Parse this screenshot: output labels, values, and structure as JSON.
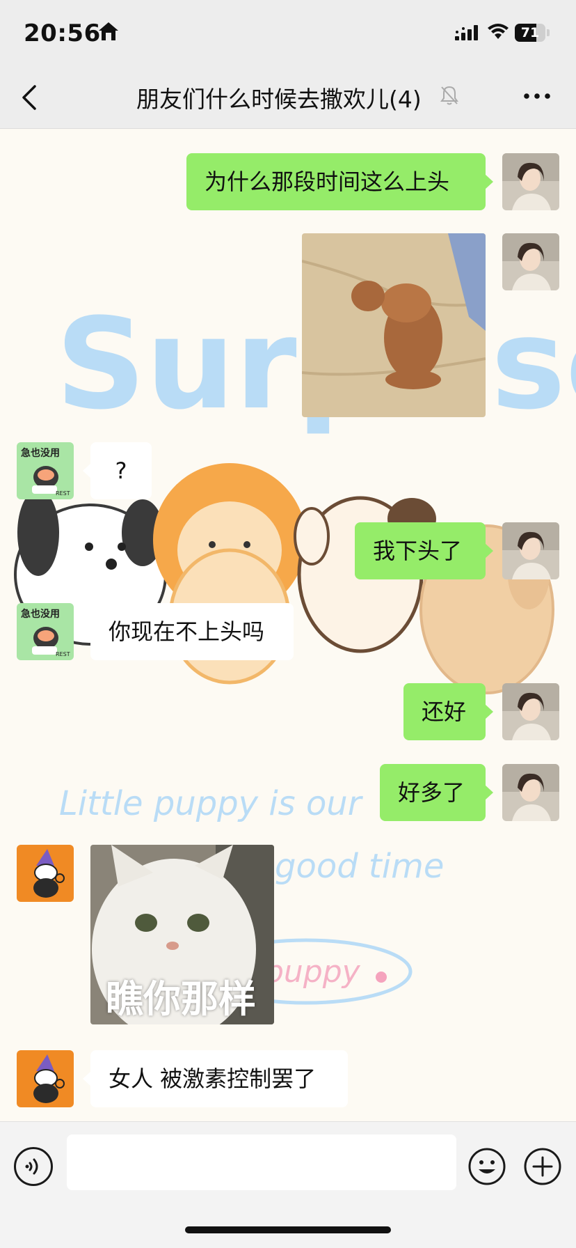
{
  "status_bar": {
    "time": "20:56",
    "battery_level": 0.71,
    "battery_text": "71"
  },
  "nav": {
    "title": "朋友们什么时候去撒欢儿(4)",
    "muted": true
  },
  "wallpaper": {
    "text1": "Surprise",
    "text2": "Little puppy is our",
    "text3": "good time",
    "text4": "puppy"
  },
  "messages": [
    {
      "side": "right",
      "type": "text",
      "text": "为什么那段时间这么上头"
    },
    {
      "side": "right",
      "type": "sticker",
      "caption": ""
    },
    {
      "side": "left",
      "type": "text",
      "text": "?"
    },
    {
      "side": "right",
      "type": "text",
      "text": "我下头了"
    },
    {
      "side": "left",
      "type": "text",
      "text": "你现在不上头吗"
    },
    {
      "side": "right",
      "type": "text",
      "text": "还好"
    },
    {
      "side": "right",
      "type": "text",
      "text": "好多了"
    },
    {
      "side": "left",
      "type": "sticker",
      "caption": "瞧你那样"
    },
    {
      "side": "left",
      "type": "text",
      "text": "女人 被激素控制罢了"
    }
  ],
  "avatar_labels": {
    "a": "急也没用",
    "b": "REST"
  },
  "colors": {
    "bubble_green": "#95ec69",
    "bubble_white": "#ffffff",
    "nav_bg": "#ededed"
  }
}
